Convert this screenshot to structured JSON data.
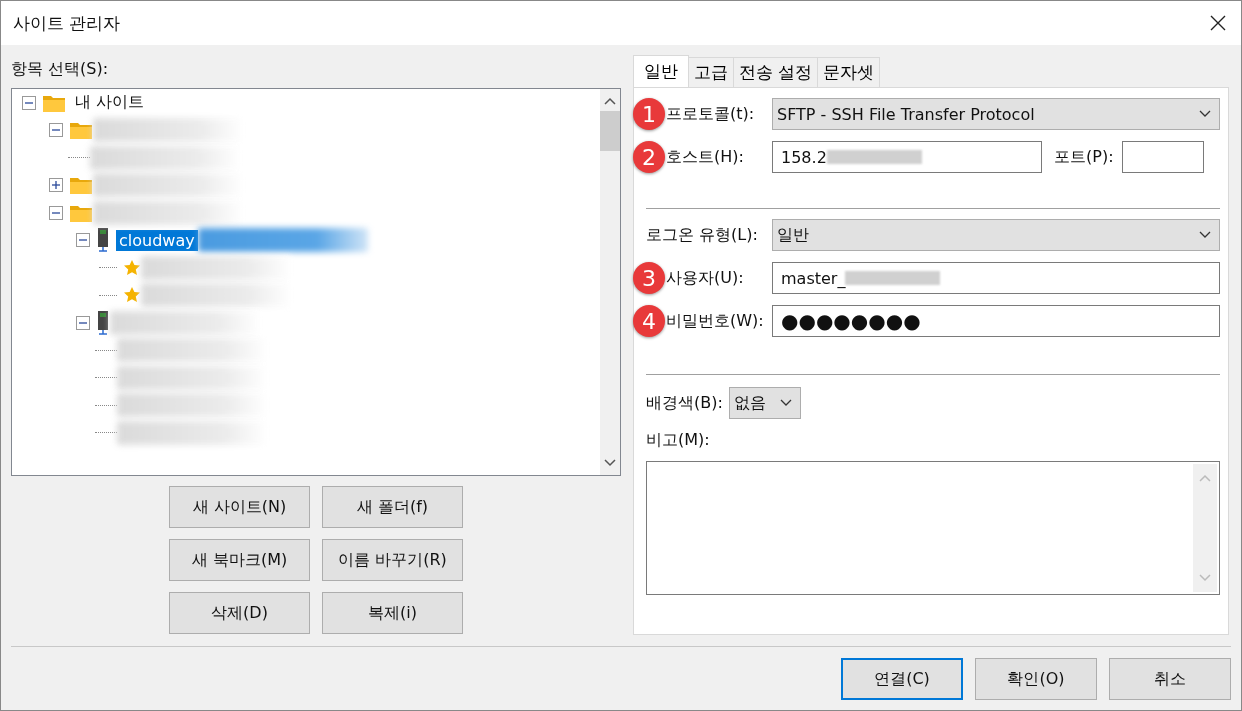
{
  "window": {
    "title": "사이트 관리자"
  },
  "tree_label": "항목 선택(S):",
  "tree": [
    {
      "kind": "folder",
      "label": "내 사이트",
      "expanded": true,
      "selected": false,
      "children": [
        {
          "kind": "folder",
          "redacted": true,
          "expanded": true,
          "selected": false,
          "children": [
            {
              "kind": "plain",
              "redacted": true,
              "selected": false
            }
          ]
        },
        {
          "kind": "folder",
          "redacted": true,
          "expanded": false,
          "selected": false
        },
        {
          "kind": "folder",
          "redacted": true,
          "expanded": true,
          "selected": false,
          "children": [
            {
              "kind": "server",
              "label": "cloudway",
              "redacted": true,
              "expanded": true,
              "selected": true,
              "children": [
                {
                  "kind": "bookmark",
                  "redacted": true,
                  "selected": false
                },
                {
                  "kind": "bookmark",
                  "redacted": true,
                  "selected": false
                }
              ]
            },
            {
              "kind": "server",
              "redacted": true,
              "expanded": true,
              "selected": false,
              "children": [
                {
                  "kind": "plain",
                  "redacted": true,
                  "selected": false
                },
                {
                  "kind": "plain",
                  "redacted": true,
                  "selected": false
                },
                {
                  "kind": "plain",
                  "redacted": true,
                  "selected": false
                },
                {
                  "kind": "plain",
                  "redacted": true,
                  "selected": false
                }
              ]
            }
          ]
        }
      ]
    }
  ],
  "tree_buttons": [
    "새 사이트(N)",
    "새 폴더(f)",
    "새 북마크(M)",
    "이름 바꾸기(R)",
    "삭제(D)",
    "복제(i)"
  ],
  "tabs": [
    {
      "label": "일반",
      "selected": true
    },
    {
      "label": "고급",
      "selected": false
    },
    {
      "label": "전송 설정",
      "selected": false
    },
    {
      "label": "문자셋",
      "selected": false
    }
  ],
  "protocol": {
    "badge": "1",
    "label": "프로토콜(t):",
    "value": "SFTP - SSH File Transfer Protocol"
  },
  "host": {
    "badge": "2",
    "label": "호스트(H):",
    "value": "158.2",
    "redacted": true
  },
  "port": {
    "label": "포트(P):"
  },
  "logon_type": {
    "label": "로그온 유형(L):",
    "value": "일반"
  },
  "user": {
    "badge": "3",
    "label": "사용자(U):",
    "value": "master_",
    "redacted": true
  },
  "password": {
    "badge": "4",
    "label": "비밀번호(W):",
    "value": "●●●●●●●●"
  },
  "background_color": {
    "label": "배경색(B):",
    "value": "없음"
  },
  "comments": {
    "label": "비고(M):"
  },
  "buttons": [
    {
      "label": "연결(C)",
      "default": true
    },
    {
      "label": "확인(O)",
      "default": false
    },
    {
      "label": "취소",
      "default": false
    }
  ]
}
